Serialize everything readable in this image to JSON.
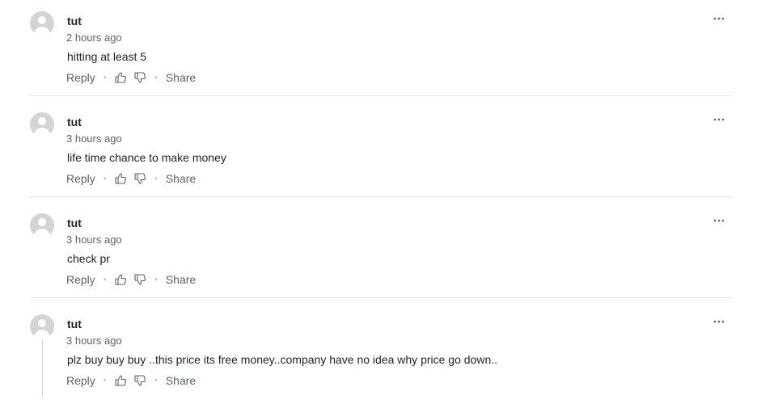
{
  "comments": [
    {
      "username": "tut",
      "timestamp": "2 hours ago",
      "text": "hitting at least 5"
    },
    {
      "username": "tut",
      "timestamp": "3 hours ago",
      "text": "life time chance to make money"
    },
    {
      "username": "tut",
      "timestamp": "3 hours ago",
      "text": "check pr"
    },
    {
      "username": "tut",
      "timestamp": "3 hours ago",
      "text": "plz buy buy buy ..this price its free money..company have no idea why price go down.."
    }
  ],
  "actions": {
    "reply_label": "Reply",
    "share_label": "Share",
    "separator": "•"
  },
  "icons": {
    "avatar": "user-avatar-icon",
    "like": "thumbs-up-icon",
    "dislike": "thumbs-down-icon",
    "more": "more-options-icon"
  },
  "colors": {
    "text": "#1d2228",
    "muted": "#5b636a",
    "avatar": "#d4d4d6",
    "divider": "#e0e4e9"
  }
}
